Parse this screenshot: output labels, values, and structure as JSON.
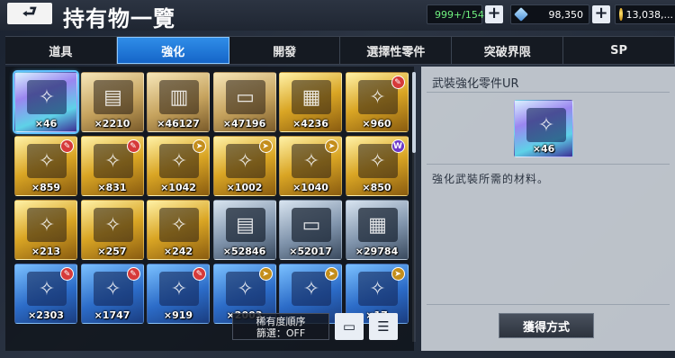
{
  "header": {
    "back_glyph": "⮐",
    "title": "持有物一覽",
    "stamina": "999+/154",
    "gems": "98,350",
    "coins": "13,038,..."
  },
  "tabs": [
    {
      "label": "道具",
      "active": false
    },
    {
      "label": "強化",
      "active": true
    },
    {
      "label": "開發",
      "active": false
    },
    {
      "label": "選擇性零件",
      "active": false
    },
    {
      "label": "突破界限",
      "active": false
    },
    {
      "label": "SP",
      "active": false
    }
  ],
  "items": [
    {
      "count": "×46",
      "rarity": "iri",
      "icon": "enhance-part-icon",
      "badge": "",
      "selected": true
    },
    {
      "count": "×2210",
      "rarity": "beige",
      "icon": "parts-box-icon",
      "badge": ""
    },
    {
      "count": "×46127",
      "rarity": "beige",
      "icon": "parts-stack-icon",
      "badge": ""
    },
    {
      "count": "×47196",
      "rarity": "beige",
      "icon": "laptop-icon",
      "badge": ""
    },
    {
      "count": "×4236",
      "rarity": "gold",
      "icon": "chip-icon",
      "badge": ""
    },
    {
      "count": "×960",
      "rarity": "gold",
      "icon": "enhance-part-icon",
      "badge": "red"
    },
    {
      "count": "×859",
      "rarity": "gold",
      "icon": "enhance-part-icon",
      "badge": "red"
    },
    {
      "count": "×831",
      "rarity": "gold",
      "icon": "enhance-part-icon",
      "badge": "red"
    },
    {
      "count": "×1042",
      "rarity": "gold",
      "icon": "enhance-part-icon",
      "badge": "gold"
    },
    {
      "count": "×1002",
      "rarity": "gold",
      "icon": "enhance-part-icon",
      "badge": "gold"
    },
    {
      "count": "×1040",
      "rarity": "gold",
      "icon": "enhance-part-icon",
      "badge": "gold"
    },
    {
      "count": "×850",
      "rarity": "gold",
      "icon": "enhance-part-icon",
      "badge": "purple"
    },
    {
      "count": "×213",
      "rarity": "gold",
      "icon": "enhance-part-icon",
      "badge": ""
    },
    {
      "count": "×257",
      "rarity": "gold",
      "icon": "enhance-part-icon",
      "badge": ""
    },
    {
      "count": "×242",
      "rarity": "gold",
      "icon": "enhance-part-icon",
      "badge": ""
    },
    {
      "count": "×52846",
      "rarity": "silver",
      "icon": "parts-box-icon",
      "badge": ""
    },
    {
      "count": "×52017",
      "rarity": "silver",
      "icon": "laptop-icon",
      "badge": ""
    },
    {
      "count": "×29784",
      "rarity": "silver",
      "icon": "chip-icon",
      "badge": ""
    },
    {
      "count": "×2303",
      "rarity": "blue",
      "icon": "enhance-part-icon",
      "badge": "red"
    },
    {
      "count": "×1747",
      "rarity": "blue",
      "icon": "enhance-part-icon",
      "badge": "red"
    },
    {
      "count": "×919",
      "rarity": "blue",
      "icon": "enhance-part-icon",
      "badge": "red"
    },
    {
      "count": "×2003",
      "rarity": "blue",
      "icon": "enhance-part-icon",
      "badge": "gold"
    },
    {
      "count": "",
      "rarity": "blue",
      "icon": "enhance-part-icon",
      "badge": "gold"
    },
    {
      "count": "×17",
      "rarity": "blue",
      "icon": "enhance-part-icon",
      "badge": "gold"
    }
  ],
  "filter": {
    "sort_label": "稀有度順序",
    "filter_label": "篩選：OFF"
  },
  "detail": {
    "title": "武裝強化零件UR",
    "count": "×46",
    "description": "強化武裝所需的材料。",
    "acquire_label": "獲得方式"
  },
  "colors": {
    "accent": "#1565c8",
    "panel_light": "#d2d7de",
    "grid_bg": "#0c1016"
  }
}
